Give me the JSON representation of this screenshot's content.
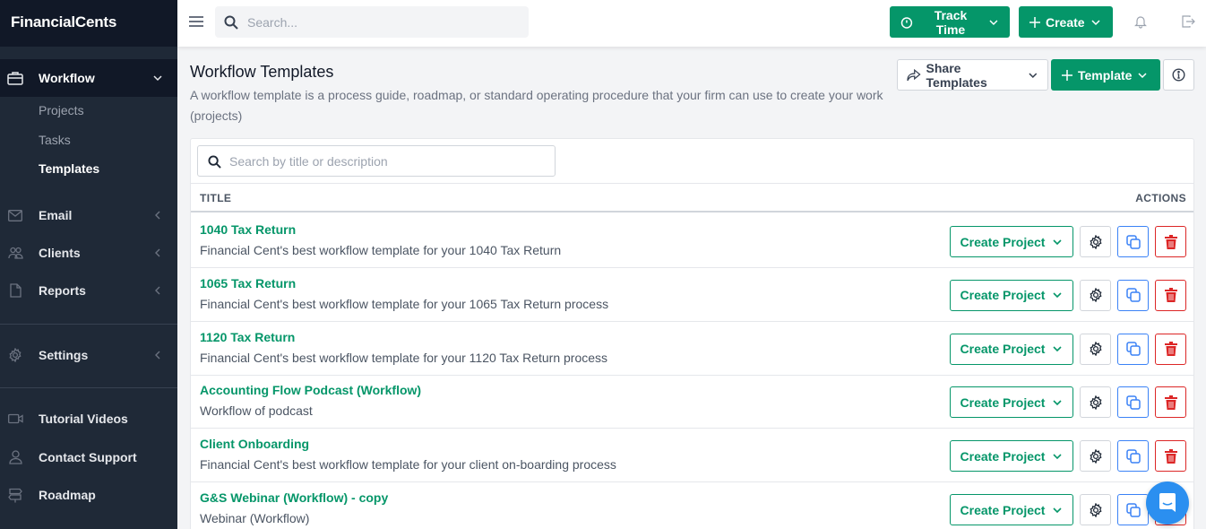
{
  "app": {
    "brand": "FinancialCents"
  },
  "sidebar": {
    "workflow": {
      "label": "Workflow",
      "icon": "briefcase-icon",
      "expanded": true
    },
    "workflow_sub": [
      {
        "label": "Projects",
        "current": false
      },
      {
        "label": "Tasks",
        "current": false
      },
      {
        "label": "Templates",
        "current": true
      }
    ],
    "items": [
      {
        "label": "Email",
        "icon": "mail-icon"
      },
      {
        "label": "Clients",
        "icon": "users-icon"
      },
      {
        "label": "Reports",
        "icon": "file-icon"
      },
      {
        "label": "Settings",
        "icon": "gear-icon"
      }
    ],
    "bottom": [
      {
        "label": "Tutorial Videos",
        "icon": "video-icon"
      },
      {
        "label": "Contact Support",
        "icon": "user-icon"
      },
      {
        "label": "Roadmap",
        "icon": "signpost-icon"
      }
    ]
  },
  "topbar": {
    "search_placeholder": "Search...",
    "track_time_label": "Track Time",
    "create_label": "Create"
  },
  "page": {
    "title": "Workflow Templates",
    "description": "A workflow template is a process guide, roadmap, or standard operating procedure that your firm can use to create your work (projects)",
    "share_label": "Share Templates",
    "template_label": "Template"
  },
  "table": {
    "search_placeholder": "Search by title or description",
    "col_title": "TITLE",
    "col_actions": "ACTIONS",
    "create_project_label": "Create Project",
    "rows": [
      {
        "title": "1040 Tax Return",
        "description": "Financial Cent's best workflow template for your 1040 Tax Return"
      },
      {
        "title": "1065 Tax Return",
        "description": "Financial Cent's best workflow template for your 1065 Tax Return process"
      },
      {
        "title": "1120 Tax Return",
        "description": "Financial Cent's best workflow template for your 1120 Tax Return process"
      },
      {
        "title": "Accounting Flow Podcast (Workflow)",
        "description": "Workflow of podcast"
      },
      {
        "title": "Client Onboarding",
        "description": "Financial Cent's best workflow template for your client on-boarding process"
      },
      {
        "title": "G&S Webinar (Workflow) - copy",
        "description": "Webinar (Workflow)"
      }
    ]
  },
  "colors": {
    "accent": "#059669",
    "sidebar": "#1f2937",
    "sidebar_dark": "#111827",
    "danger": "#dc2626",
    "copy": "#3b82f6",
    "chat": "#2b8ff0"
  }
}
